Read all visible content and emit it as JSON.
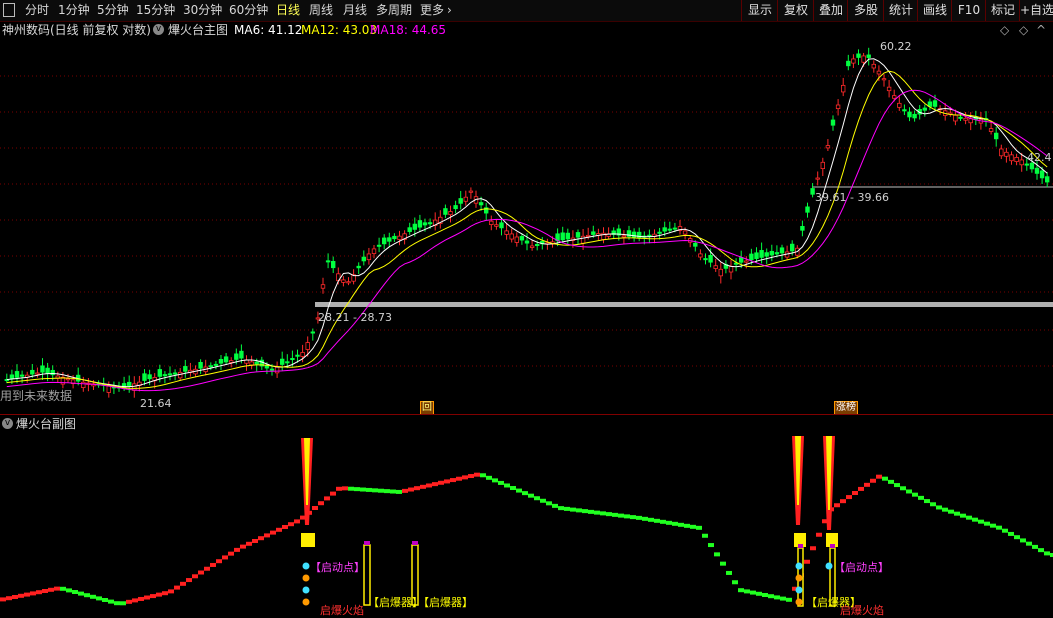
{
  "toolbar": {
    "left_items": [
      "分时",
      "1分钟",
      "5分钟",
      "15分钟",
      "30分钟",
      "60分钟",
      "日线",
      "周线",
      "月线",
      "多周期",
      "更多"
    ],
    "active_item": "日线",
    "more_arrow": "chevron-right-icon",
    "right_items": [
      "显示",
      "复权",
      "叠加",
      "多股",
      "统计",
      "画线",
      "F10",
      "标记",
      "+自选"
    ]
  },
  "main_chart": {
    "stock_title": "神州数码(日线 前复权 对数)",
    "indicator_name": "熚火台主图",
    "ma6": "MA6: 41.12",
    "ma12": "MA12: 43.03",
    "ma18": "MA18: 44.65",
    "price_high_label": "60.22",
    "price_right_label": "42.4",
    "range_label_1": "39.61 - 39.66",
    "range_label_2": "28.21 - 28.73",
    "low_label": "21.64",
    "future_data_note": "用到未来数据",
    "marker_hui": "回",
    "marker_zhangting": "涨榜",
    "colors": {
      "up": "#ff2a2a",
      "down": "#00ff40",
      "ma6": "#ffffff",
      "ma12": "#ffff00",
      "ma18": "#ff00ff",
      "grid": "#7a0000"
    }
  },
  "sub_chart": {
    "title": "熚火台副图",
    "signals": {
      "qidongdian": "启动点",
      "qibaoqi": "启爆器",
      "qibao_huoyan": "启爆火焰"
    }
  },
  "chart_data": {
    "type": "candlestick",
    "title": "熚火台主图",
    "ylim": [
      21.64,
      60.22
    ],
    "log_scale": true,
    "legend": "top-left",
    "series": [
      {
        "name": "MA6",
        "value": 41.12
      },
      {
        "name": "MA12",
        "value": 43.03
      },
      {
        "name": "MA18",
        "value": 44.65
      }
    ],
    "annotations": [
      "60.22",
      "42.4",
      "39.61 - 39.66",
      "28.21 - 28.73",
      "21.64"
    ]
  }
}
